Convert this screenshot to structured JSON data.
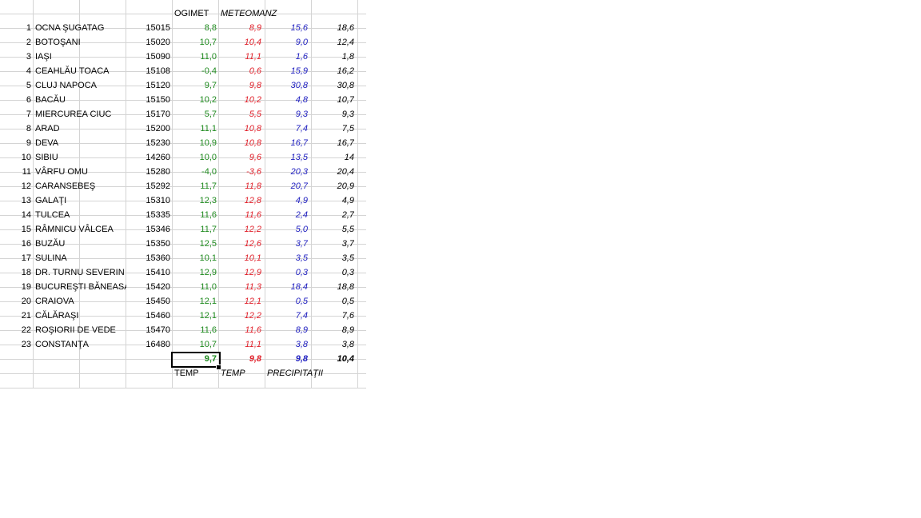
{
  "header": {
    "ogimet": "OGIMET",
    "meteomanz": "METEOMANZ"
  },
  "rows": [
    {
      "n": "1",
      "name": "OCNA ŞUGATAG",
      "code": "15015",
      "og": "8,8",
      "mt": "8,9",
      "pr": "15,6",
      "p2": "18,6"
    },
    {
      "n": "2",
      "name": "BOTOŞANI",
      "code": "15020",
      "og": "10,7",
      "mt": "10,4",
      "pr": "9,0",
      "p2": "12,4"
    },
    {
      "n": "3",
      "name": "IAŞI",
      "code": "15090",
      "og": "11,0",
      "mt": "11,1",
      "pr": "1,6",
      "p2": "1,8"
    },
    {
      "n": "4",
      "name": "CEAHLĂU TOACA",
      "code": "15108",
      "og": "-0,4",
      "mt": "0,6",
      "pr": "15,9",
      "p2": "16,2"
    },
    {
      "n": "5",
      "name": "CLUJ NAPOCA",
      "code": "15120",
      "og": "9,7",
      "mt": "9,8",
      "pr": "30,8",
      "p2": "30,8"
    },
    {
      "n": "6",
      "name": "BACĂU",
      "code": "15150",
      "og": "10,2",
      "mt": "10,2",
      "pr": "4,8",
      "p2": "10,7"
    },
    {
      "n": "7",
      "name": "MIERCUREA CIUC",
      "code": "15170",
      "og": "5,7",
      "mt": "5,5",
      "pr": "9,3",
      "p2": "9,3"
    },
    {
      "n": "8",
      "name": "ARAD",
      "code": "15200",
      "og": "11,1",
      "mt": "10,8",
      "pr": "7,4",
      "p2": "7,5"
    },
    {
      "n": "9",
      "name": "DEVA",
      "code": "15230",
      "og": "10,9",
      "mt": "10,8",
      "pr": "16,7",
      "p2": "16,7"
    },
    {
      "n": "10",
      "name": "SIBIU",
      "code": "14260",
      "og": "10,0",
      "mt": "9,6",
      "pr": "13,5",
      "p2": "14"
    },
    {
      "n": "11",
      "name": "VÂRFU OMU",
      "code": "15280",
      "og": "-4,0",
      "mt": "-3,6",
      "pr": "20,3",
      "p2": "20,4"
    },
    {
      "n": "12",
      "name": "CARANSEBEŞ",
      "code": "15292",
      "og": "11,7",
      "mt": "11,8",
      "pr": "20,7",
      "p2": "20,9"
    },
    {
      "n": "13",
      "name": "GALAŢI",
      "code": "15310",
      "og": "12,3",
      "mt": "12,8",
      "pr": "4,9",
      "p2": "4,9"
    },
    {
      "n": "14",
      "name": "TULCEA",
      "code": "15335",
      "og": "11,6",
      "mt": "11,6",
      "pr": "2,4",
      "p2": "2,7"
    },
    {
      "n": "15",
      "name": "RÂMNICU VÂLCEA",
      "code": "15346",
      "og": "11,7",
      "mt": "12,2",
      "pr": "5,0",
      "p2": "5,5"
    },
    {
      "n": "16",
      "name": "BUZĂU",
      "code": "15350",
      "og": "12,5",
      "mt": "12,6",
      "pr": "3,7",
      "p2": "3,7"
    },
    {
      "n": "17",
      "name": "SULINA",
      "code": "15360",
      "og": "10,1",
      "mt": "10,1",
      "pr": "3,5",
      "p2": "3,5"
    },
    {
      "n": "18",
      "name": "DR. TURNU SEVERIN",
      "code": "15410",
      "og": "12,9",
      "mt": "12,9",
      "pr": "0,3",
      "p2": "0,3"
    },
    {
      "n": "19",
      "name": "BUCUREŞTI BĂNEASA",
      "code": "15420",
      "og": "11,0",
      "mt": "11,3",
      "pr": "18,4",
      "p2": "18,8"
    },
    {
      "n": "20",
      "name": "CRAIOVA",
      "code": "15450",
      "og": "12,1",
      "mt": "12,1",
      "pr": "0,5",
      "p2": "0,5"
    },
    {
      "n": "21",
      "name": "CĂLĂRAŞI",
      "code": "15460",
      "og": "12,1",
      "mt": "12,2",
      "pr": "7,4",
      "p2": "7,6"
    },
    {
      "n": "22",
      "name": "ROŞIORII DE VEDE",
      "code": "15470",
      "og": "11,6",
      "mt": "11,6",
      "pr": "8,9",
      "p2": "8,9"
    },
    {
      "n": "23",
      "name": "CONSTANŢA",
      "code": "16480",
      "og": "10,7",
      "mt": "11,1",
      "pr": "3,8",
      "p2": "3,8"
    }
  ],
  "averages": {
    "og": "9,7",
    "mt": "9,8",
    "pr": "9,8",
    "p2": "10,4"
  },
  "footer": {
    "temp1": "TEMP",
    "temp2": "TEMP",
    "precip": "PRECIPITAŢII"
  },
  "colors": {
    "ogimet": "#1e8a1e",
    "meteomanz": "#e0202a",
    "precip": "#2020c0",
    "grid": "#d4d4d4"
  }
}
